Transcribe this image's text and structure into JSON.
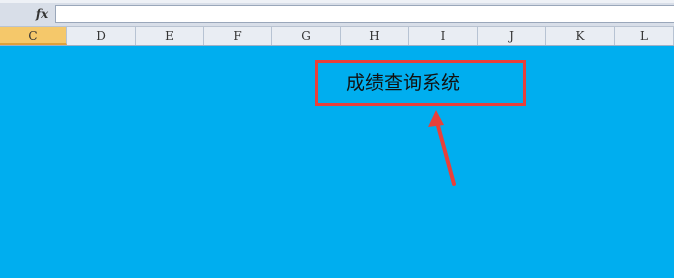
{
  "formula_bar": {
    "fx_label": "fx",
    "value": ""
  },
  "columns": [
    {
      "label": "C",
      "selected": true
    },
    {
      "label": "D",
      "selected": false
    },
    {
      "label": "E",
      "selected": false
    },
    {
      "label": "F",
      "selected": false
    },
    {
      "label": "G",
      "selected": false
    },
    {
      "label": "H",
      "selected": false
    },
    {
      "label": "I",
      "selected": false
    },
    {
      "label": "J",
      "selected": false
    },
    {
      "label": "K",
      "selected": false
    },
    {
      "label": "L",
      "selected": false
    }
  ],
  "sheet": {
    "fill_color": "#00aeef",
    "title_box_text": "成绩查询系统",
    "title_box_border_color": "#e8403a",
    "arrow_color": "#e8403a"
  }
}
